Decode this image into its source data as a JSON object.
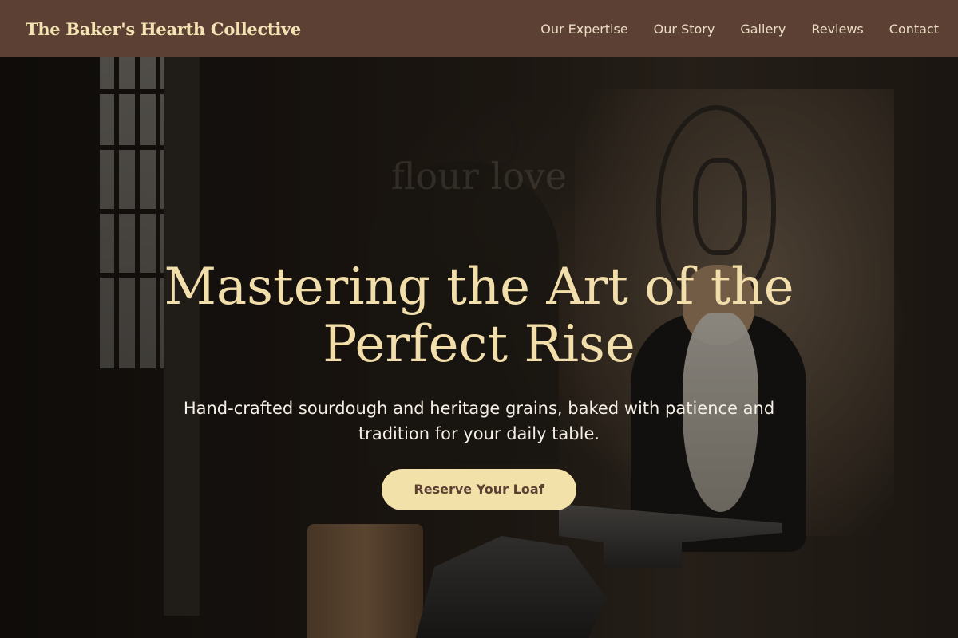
{
  "header": {
    "brand": "The Baker's Hearth Collective",
    "nav": [
      {
        "label": "Our Expertise"
      },
      {
        "label": "Our Story"
      },
      {
        "label": "Gallery"
      },
      {
        "label": "Reviews"
      },
      {
        "label": "Contact"
      }
    ]
  },
  "hero": {
    "headline": "Mastering the Art of the Perfect Rise",
    "ghost_text": "flour love",
    "subtitle": "Hand-crafted sourdough and heritage grains, baked with patience and tradition for your daily table.",
    "cta_label": "Reserve Your Loaf"
  },
  "colors": {
    "header_bg": "#5c4033",
    "brand_text": "#f3e3b3",
    "headline": "#f1deaa",
    "cta_bg": "#f2e2a9",
    "cta_text": "#5c4033"
  }
}
